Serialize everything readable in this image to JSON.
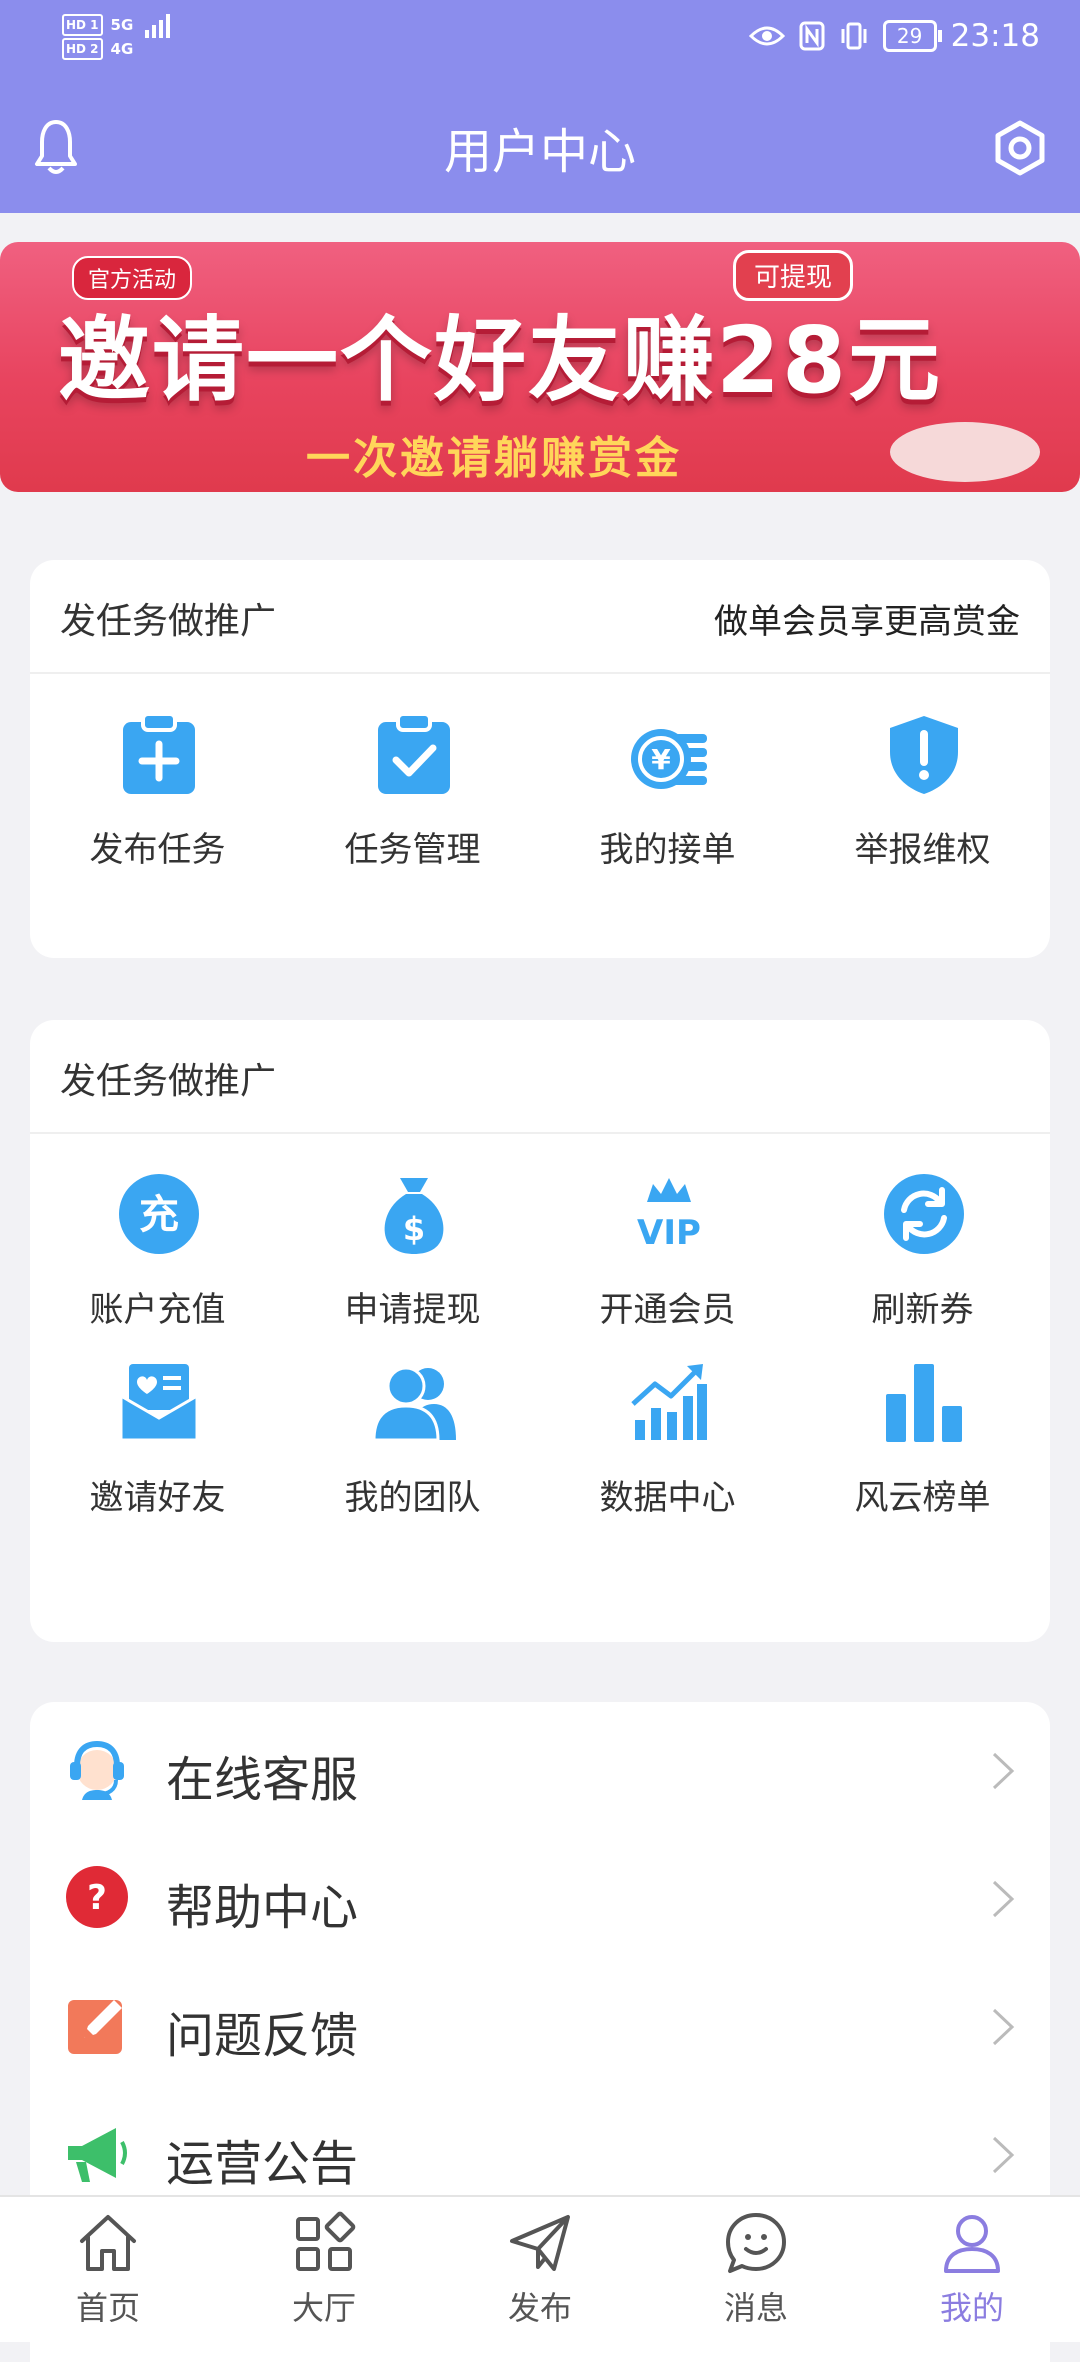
{
  "status_bar": {
    "time": "23:18",
    "battery": "29",
    "sim1": "HD 1",
    "sim2": "HD 2",
    "net1": "5G",
    "net2": "4G"
  },
  "header": {
    "title": "用户中心",
    "bell_icon": "bell-icon",
    "settings_icon": "gear-icon"
  },
  "banner": {
    "tag": "官方活动",
    "badge": "可提现",
    "headline": "邀请一个好友赚28元",
    "subline": "一次邀请躺赚赏金"
  },
  "card1": {
    "title": "发任务做推广",
    "right_text": "做单会员享更高赏金",
    "items": [
      {
        "label": "发布任务",
        "icon": "clipboard-add-icon"
      },
      {
        "label": "任务管理",
        "icon": "clipboard-check-icon"
      },
      {
        "label": "我的接单",
        "icon": "yuan-coin-icon"
      },
      {
        "label": "举报维权",
        "icon": "shield-alert-icon"
      }
    ]
  },
  "card2": {
    "title": "发任务做推广",
    "items": [
      {
        "label": "账户充值",
        "icon": "recharge-icon",
        "glyph": "充"
      },
      {
        "label": "申请提现",
        "icon": "money-bag-icon",
        "glyph": "$"
      },
      {
        "label": "开通会员",
        "icon": "vip-crown-icon",
        "glyph": "VIP"
      },
      {
        "label": "刷新券",
        "icon": "refresh-icon"
      },
      {
        "label": "邀请好友",
        "icon": "invite-envelope-icon"
      },
      {
        "label": "我的团队",
        "icon": "team-icon"
      },
      {
        "label": "数据中心",
        "icon": "data-chart-icon"
      },
      {
        "label": "风云榜单",
        "icon": "ranking-bar-icon"
      }
    ]
  },
  "menu": [
    {
      "label": "在线客服",
      "icon": "customer-service-icon"
    },
    {
      "label": "帮助中心",
      "icon": "help-icon"
    },
    {
      "label": "问题反馈",
      "icon": "feedback-edit-icon"
    },
    {
      "label": "运营公告",
      "icon": "announcement-icon"
    }
  ],
  "tabbar": [
    {
      "label": "首页",
      "icon": "home-icon",
      "active": false
    },
    {
      "label": "大厅",
      "icon": "grid-icon",
      "active": false
    },
    {
      "label": "发布",
      "icon": "send-icon",
      "active": false
    },
    {
      "label": "消息",
      "icon": "message-icon",
      "active": false
    },
    {
      "label": "我的",
      "icon": "profile-icon",
      "active": true
    }
  ],
  "colors": {
    "header": "#8b8ded",
    "accent_blue": "#3aa6f2",
    "active_tab": "#8b7de0",
    "banner_red": "#e8445f"
  }
}
